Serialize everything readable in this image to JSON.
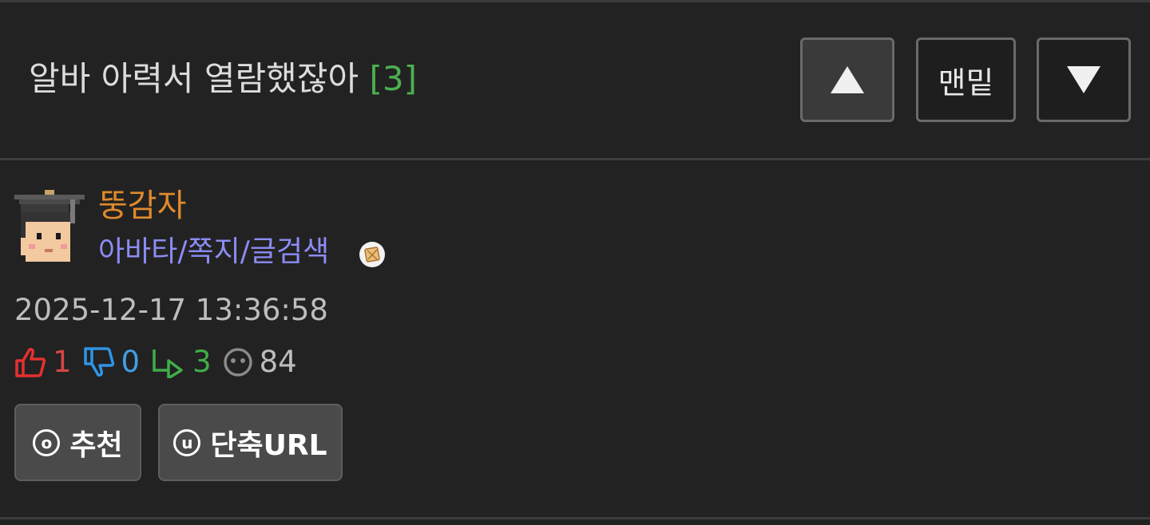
{
  "post": {
    "title": "알바 아력서 열람했잖아",
    "comment_count": "[3]",
    "author": "뚱감자",
    "author_links": "아바타/쪽지/글검색",
    "datetime": "2025-12-17 13:36:58"
  },
  "nav": {
    "up_icon": "triangle-up-icon",
    "bottom_label": "맨밑",
    "down_icon": "triangle-down-icon"
  },
  "stats": {
    "upvotes": "1",
    "downvotes": "0",
    "replies": "3",
    "views": "84"
  },
  "actions": {
    "recommend_key": "o",
    "recommend_label": "추천",
    "shorturl_key": "u",
    "shorturl_label": "단축URL"
  },
  "colors": {
    "background": "#222222",
    "comment_count": "#4caf50",
    "author": "#e08a2c",
    "links": "#8c8cf5",
    "upvote": "#d64545",
    "downvote": "#3ea0e8",
    "reply": "#3fae4a"
  }
}
